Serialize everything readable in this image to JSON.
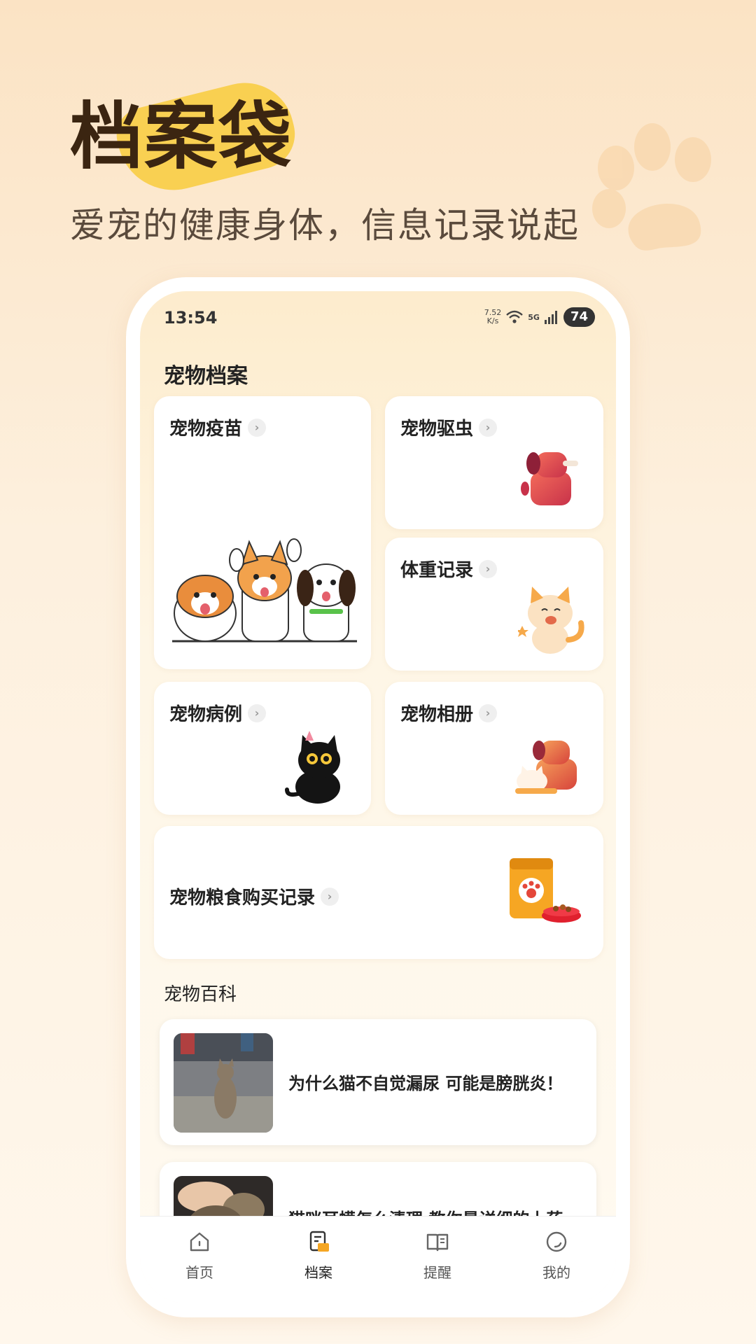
{
  "hero": {
    "title": "档案袋",
    "subtitle": "爱宠的健康身体，信息记录说起"
  },
  "status_bar": {
    "time": "13:54",
    "net_speed_value": "7.52",
    "net_speed_unit": "K/s",
    "network": "5G",
    "battery": "74"
  },
  "archive": {
    "section_title": "宠物档案",
    "cards": [
      {
        "label": "宠物疫苗",
        "icon": "three-dogs-illustration"
      },
      {
        "label": "宠物驱虫",
        "icon": "dog-with-bone-illustration"
      },
      {
        "label": "体重记录",
        "icon": "orange-cat-illustration"
      },
      {
        "label": "宠物病例",
        "icon": "black-cat-illustration"
      },
      {
        "label": "宠物相册",
        "icon": "dog-and-cat-illustration"
      },
      {
        "label": "宠物粮食购买记录",
        "icon": "pet-food-bag-illustration"
      }
    ]
  },
  "encyclopedia": {
    "section_title": "宠物百科",
    "articles": [
      {
        "title": "为什么猫不自觉漏尿 可能是膀胱炎！"
      },
      {
        "title": "猫咪耳螨怎么清理 教你最详细的上药"
      }
    ]
  },
  "tabbar": {
    "tabs": [
      {
        "label": "首页",
        "icon": "home-icon",
        "active": false
      },
      {
        "label": "档案",
        "icon": "file-icon",
        "active": true
      },
      {
        "label": "提醒",
        "icon": "book-icon",
        "active": false
      },
      {
        "label": "我的",
        "icon": "profile-icon",
        "active": false
      }
    ]
  },
  "colors": {
    "accent_yellow": "#f9cf4b",
    "title_brown": "#3b2511",
    "page_bg": "#fbe3c4",
    "tab_active": "#f5a623"
  }
}
